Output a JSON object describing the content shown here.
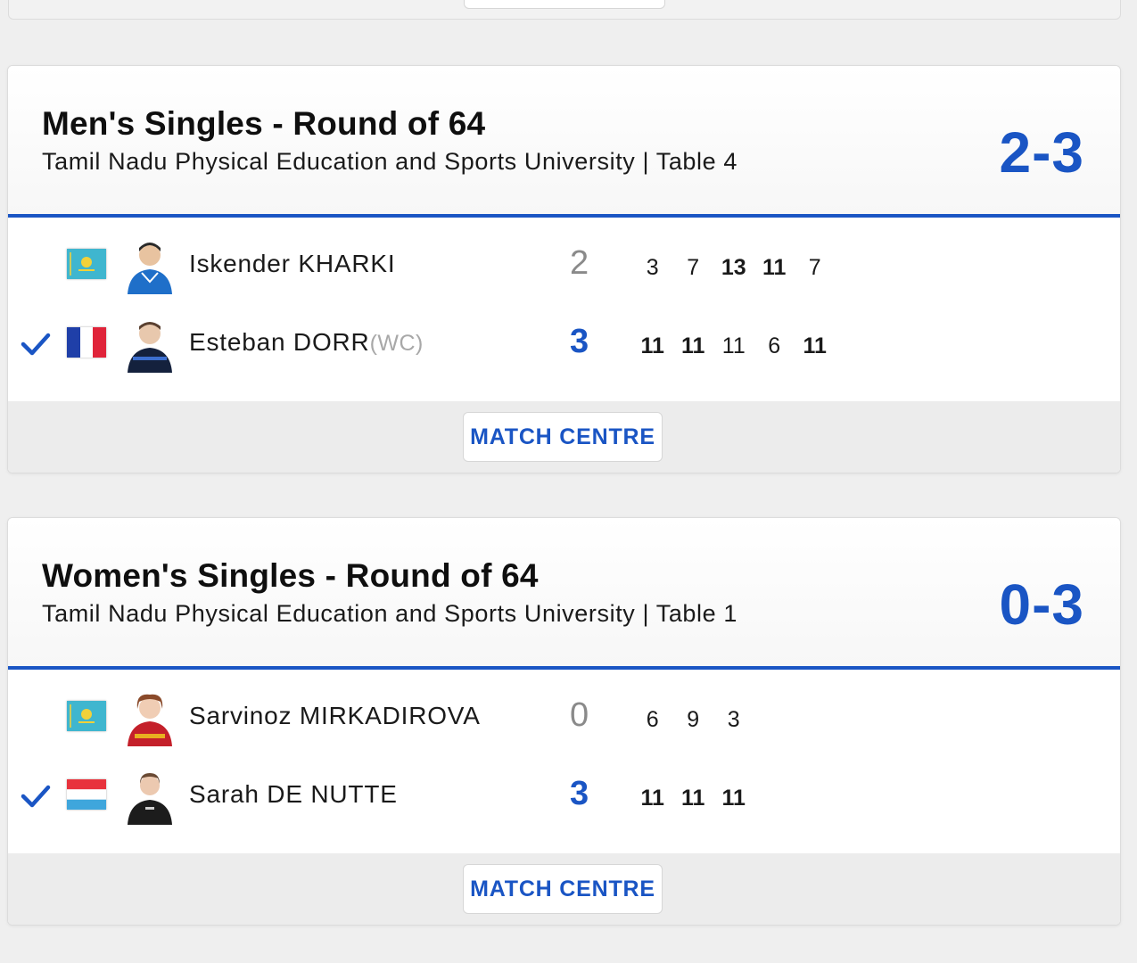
{
  "footer_button_label": "MATCH CENTRE",
  "accent_color": "#1a55c4",
  "matches": [
    {
      "event": "Men's Singles - Round of 64",
      "venue": "Tamil Nadu Physical Education and Sports University | Table 4",
      "score": "2-3",
      "players": [
        {
          "name": "Iskender KHARKI",
          "seed": "",
          "flag": "kazakhstan-flag",
          "winner": false,
          "sets": "2",
          "games": [
            "3",
            "7",
            "13",
            "11",
            "7"
          ],
          "games_won": [
            false,
            false,
            true,
            true,
            false
          ]
        },
        {
          "name": "Esteban DORR",
          "seed": "(WC)",
          "flag": "france-flag",
          "winner": true,
          "sets": "3",
          "games": [
            "11",
            "11",
            "11",
            "6",
            "11"
          ],
          "games_won": [
            true,
            true,
            false,
            false,
            true
          ]
        }
      ],
      "button": "MATCH CENTRE"
    },
    {
      "event": "Women's Singles - Round of 64",
      "venue": "Tamil Nadu Physical Education and Sports University | Table 1",
      "score": "0-3",
      "players": [
        {
          "name": "Sarvinoz MIRKADIROVA",
          "seed": "",
          "flag": "kazakhstan-flag",
          "winner": false,
          "sets": "0",
          "games": [
            "6",
            "9",
            "3"
          ],
          "games_won": [
            false,
            false,
            false
          ]
        },
        {
          "name": "Sarah DE NUTTE",
          "seed": "",
          "flag": "luxembourg-flag",
          "winner": true,
          "sets": "3",
          "games": [
            "11",
            "11",
            "11"
          ],
          "games_won": [
            true,
            true,
            true
          ]
        }
      ],
      "button": "MATCH CENTRE"
    }
  ]
}
